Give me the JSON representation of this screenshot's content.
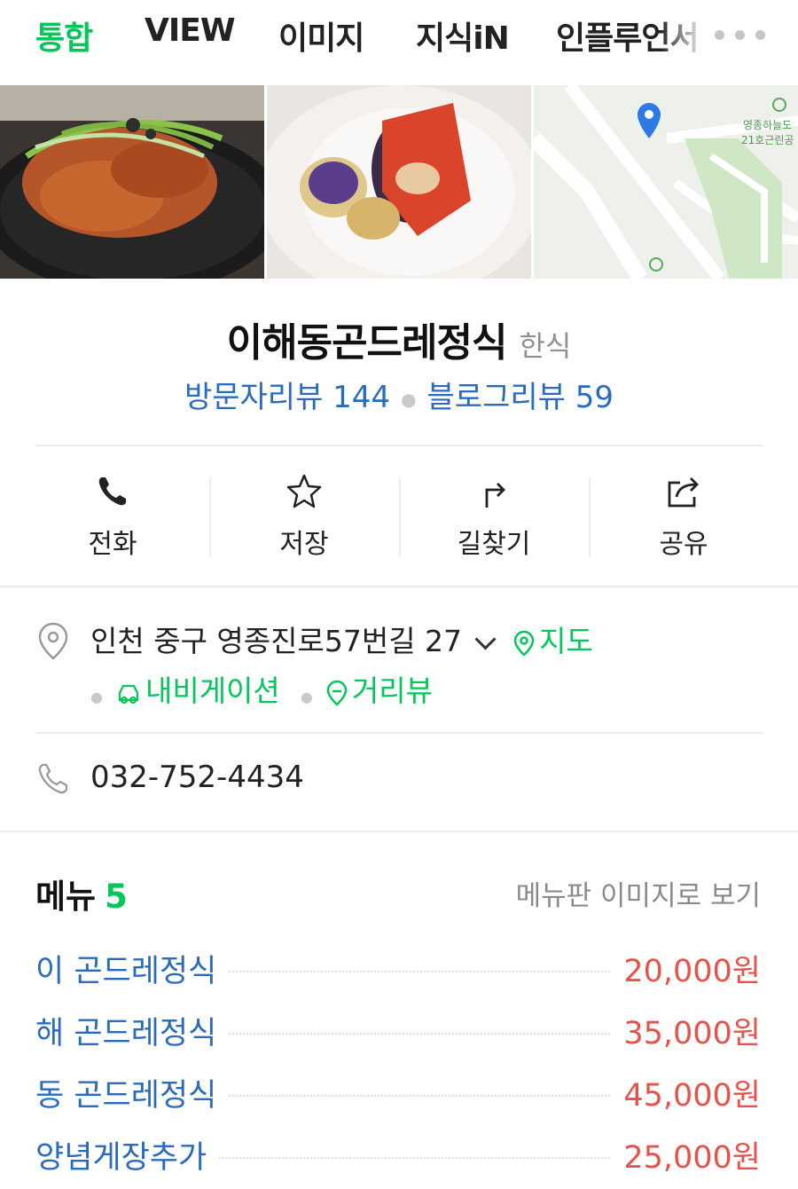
{
  "tabs": [
    {
      "label": "통합",
      "active": true
    },
    {
      "label": "VIEW"
    },
    {
      "label": "이미지"
    },
    {
      "label": "지식iN"
    },
    {
      "label": "인플루언서"
    }
  ],
  "map_thumb": {
    "label_line1": "영종하늘도",
    "label_line2": "21호근린공"
  },
  "place": {
    "name": "이해동곤드레정식",
    "category": "한식"
  },
  "reviews": {
    "visitor": "방문자리뷰 144",
    "blog": "블로그리뷰 59"
  },
  "actions": [
    {
      "label": "전화",
      "icon": "phone-icon"
    },
    {
      "label": "저장",
      "icon": "star-icon"
    },
    {
      "label": "길찾기",
      "icon": "directions-icon"
    },
    {
      "label": "공유",
      "icon": "share-icon"
    }
  ],
  "address": {
    "text": "인천 중구 영종진로57번길 27",
    "map_link": "지도",
    "navigation_link": "내비게이션",
    "streetview_link": "거리뷰"
  },
  "phone": {
    "number": "032-752-4434"
  },
  "menu": {
    "title": "메뉴",
    "count": "5",
    "image_link": "메뉴판 이미지로 보기",
    "items": [
      {
        "name": "이 곤드레정식",
        "price": "20,000원"
      },
      {
        "name": "해 곤드레정식",
        "price": "35,000원"
      },
      {
        "name": "동 곤드레정식",
        "price": "45,000원"
      },
      {
        "name": "양념게장추가",
        "price": "25,000원"
      }
    ]
  },
  "colors": {
    "accent_green": "#03c75a",
    "link_blue": "#2a6bbd",
    "price_red": "#e5534b"
  }
}
